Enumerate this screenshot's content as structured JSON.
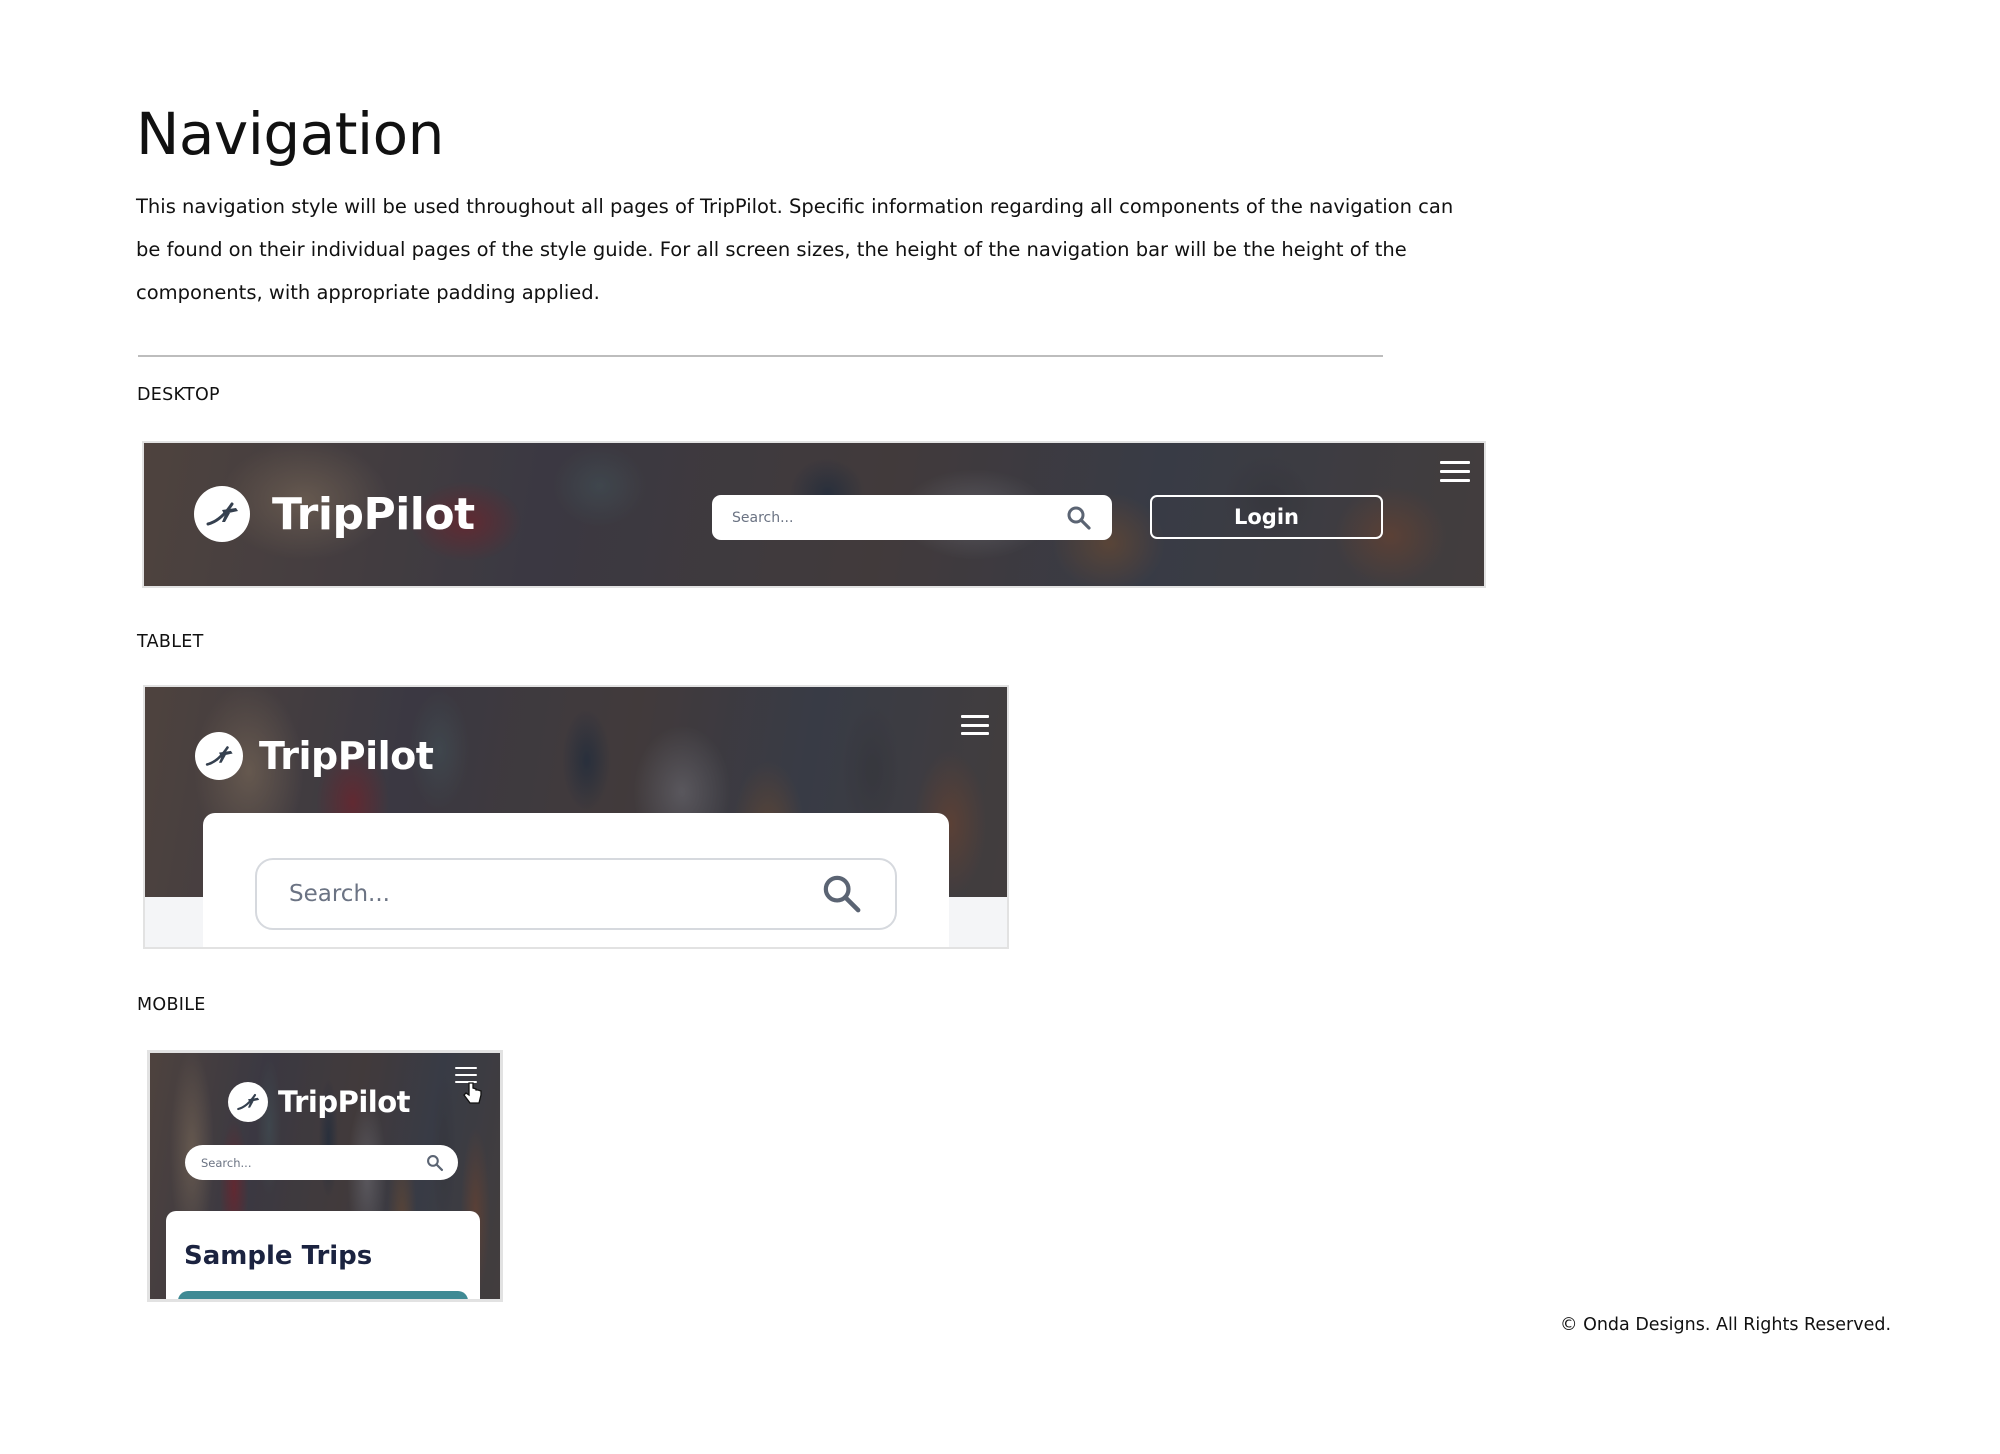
{
  "page": {
    "title": "Navigation",
    "intro": "This navigation style will be used throughout all pages of TripPilot. Specific information regarding all components of the navigation can be found on their individual pages of the style guide. For all screen sizes, the height of the navigation bar will be the height of the components, with appropriate padding applied."
  },
  "sections": {
    "desktop_label": "DESKTOP",
    "tablet_label": "TABLET",
    "mobile_label": "MOBILE"
  },
  "desktop": {
    "brand": "TripPilot",
    "search_placeholder": "Search...",
    "login_label": "Login"
  },
  "tablet": {
    "brand": "TripPilot",
    "search_placeholder": "Search..."
  },
  "mobile": {
    "brand": "TripPilot",
    "search_placeholder": "Search...",
    "card_title": "Sample Trips"
  },
  "footer": {
    "copyright": "© Onda Designs. All Rights Reserved."
  },
  "colors": {
    "page_bg": "#ffffff",
    "rule": "#bdbdbd",
    "nav_text": "#ffffff",
    "search_icon": "#5b6473",
    "card_title": "#1b2340",
    "card_strip": "#3f8a94"
  },
  "icons": [
    "plane-logo-icon",
    "search-icon",
    "hamburger-menu-icon",
    "pointer-cursor-icon"
  ]
}
